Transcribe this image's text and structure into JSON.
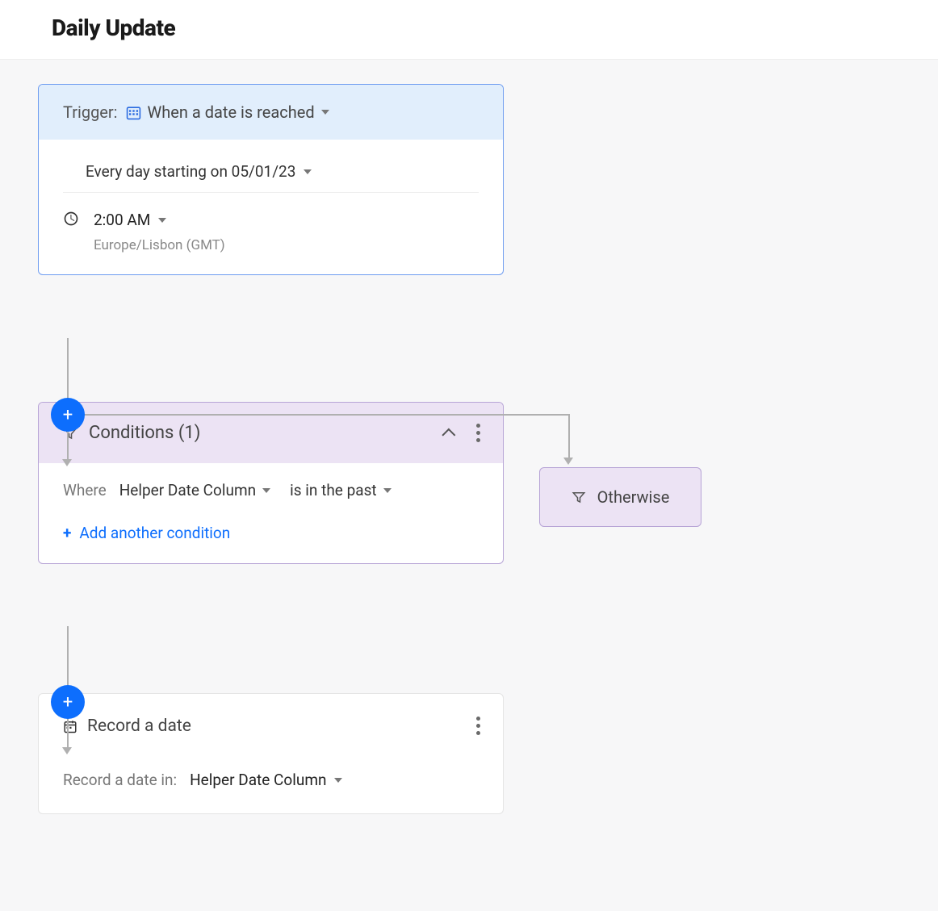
{
  "header": {
    "title": "Daily Update"
  },
  "trigger": {
    "label": "Trigger:",
    "type_label": "When a date is reached",
    "schedule_text": "Every day starting on 05/01/23",
    "time": "2:00 AM",
    "timezone": "Europe/Lisbon (GMT)"
  },
  "conditions": {
    "title": "Conditions (1)",
    "where_label": "Where",
    "field": "Helper Date Column",
    "operator": "is in the past",
    "add_label": "Add another condition"
  },
  "otherwise": {
    "label": "Otherwise"
  },
  "action": {
    "title": "Record a date",
    "field_label": "Record a date in:",
    "field_value": "Helper Date Column"
  }
}
